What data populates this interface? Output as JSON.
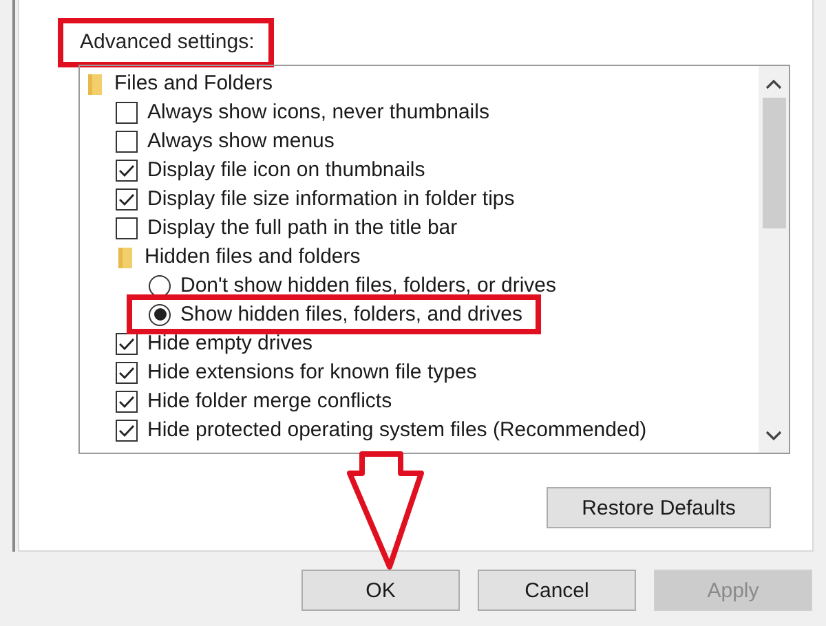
{
  "panel": {
    "label": "Advanced settings:",
    "label_highlighted": true
  },
  "settings": [
    {
      "kind": "folder",
      "label": "Files and Folders",
      "children": [
        {
          "kind": "checkbox",
          "label": "Always show icons, never thumbnails",
          "checked": false
        },
        {
          "kind": "checkbox",
          "label": "Always show menus",
          "checked": false
        },
        {
          "kind": "checkbox",
          "label": "Display file icon on thumbnails",
          "checked": true
        },
        {
          "kind": "checkbox",
          "label": "Display file size information in folder tips",
          "checked": true
        },
        {
          "kind": "checkbox",
          "label": "Display the full path in the title bar",
          "checked": false
        },
        {
          "kind": "folder",
          "label": "Hidden files and folders",
          "children": [
            {
              "kind": "radio",
              "label": "Don't show hidden files, folders, or drives",
              "selected": false,
              "highlighted": false
            },
            {
              "kind": "radio",
              "label": "Show hidden files, folders, and drives",
              "selected": true,
              "highlighted": true
            }
          ]
        },
        {
          "kind": "checkbox",
          "label": "Hide empty drives",
          "checked": true
        },
        {
          "kind": "checkbox",
          "label": "Hide extensions for known file types",
          "checked": true
        },
        {
          "kind": "checkbox",
          "label": "Hide folder merge conflicts",
          "checked": true
        },
        {
          "kind": "checkbox",
          "label": "Hide protected operating system files (Recommended)",
          "checked": true
        }
      ]
    }
  ],
  "restore_button": "Restore Defaults",
  "buttons": [
    {
      "label": "OK",
      "disabled": false
    },
    {
      "label": "Cancel",
      "disabled": false
    },
    {
      "label": "Apply",
      "disabled": true
    }
  ]
}
